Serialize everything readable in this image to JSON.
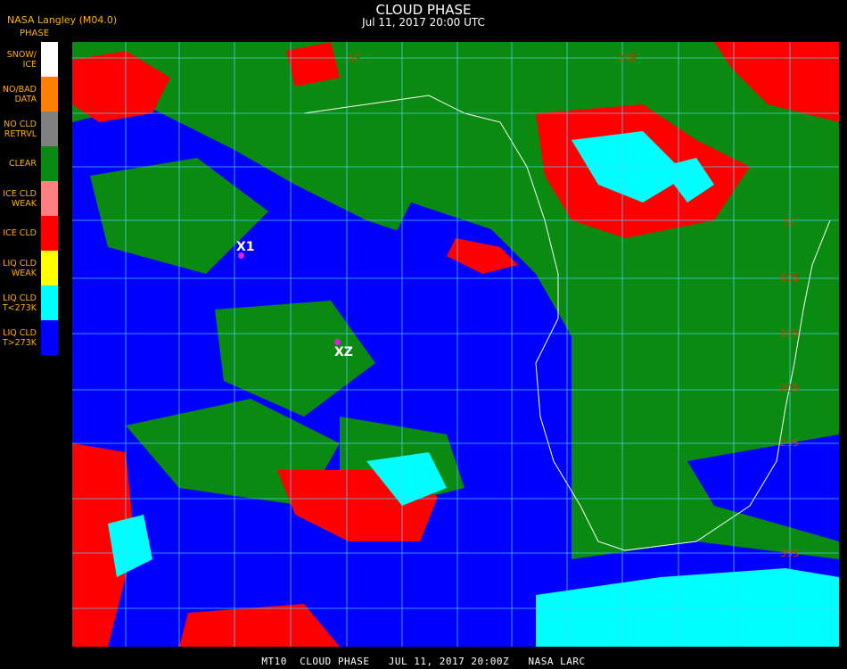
{
  "header": {
    "title": "CLOUD PHASE",
    "subtitle": "Jul 11, 2017 20:00 UTC",
    "source": "NASA Langley (M04.0)"
  },
  "legend": {
    "title": "PHASE",
    "items": [
      {
        "label": "SNOW/\nICE",
        "color": "#ffffff"
      },
      {
        "label": "NO/BAD\nDATA",
        "color": "#ff7f00"
      },
      {
        "label": "NO CLD\nRETRVL",
        "color": "#808080"
      },
      {
        "label": "CLEAR",
        "color": "#0a8a10"
      },
      {
        "label": "ICE CLD\nWEAK",
        "color": "#ff8080"
      },
      {
        "label": "ICE CLD",
        "color": "#ff0000"
      },
      {
        "label": "LIQ CLD\nWEAK",
        "color": "#ffff00"
      },
      {
        "label": "LIQ CLD\nT<273K",
        "color": "#00ffff"
      },
      {
        "label": "LIQ CLD\nT>273K",
        "color": "#0000ff"
      }
    ]
  },
  "markers": [
    {
      "label": "X1"
    },
    {
      "label": "XZ"
    }
  ],
  "grid_labels": {
    "lon_top": [
      "5E",
      "20E"
    ],
    "lat_right": [
      "5S",
      "10S",
      "15S",
      "20S",
      "25S",
      "35S"
    ]
  },
  "footer": "MT10  CLOUD PHASE   JUL 11, 2017 20:00Z   NASA LARC"
}
